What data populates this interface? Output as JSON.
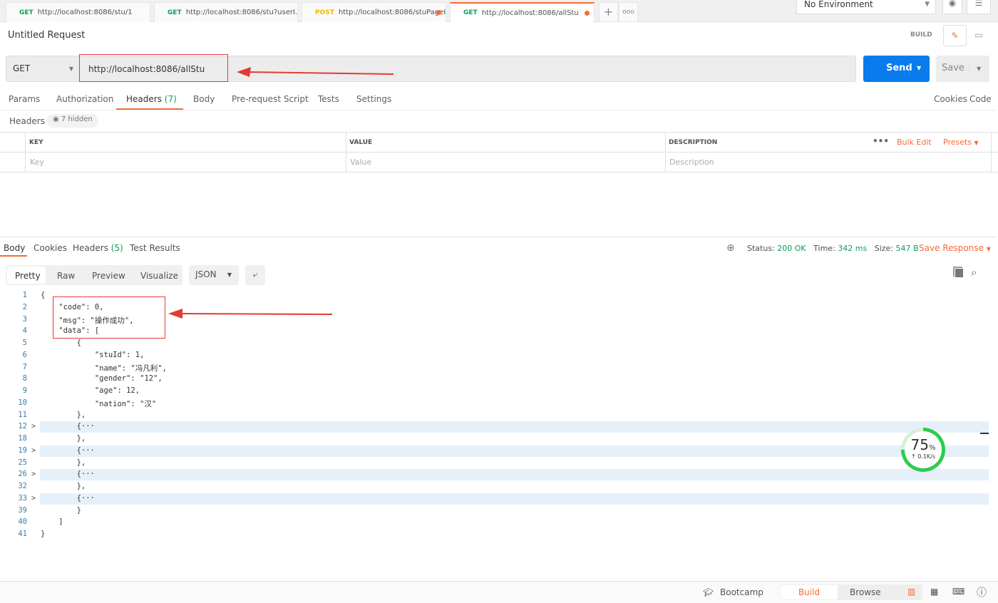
{
  "tabs": [
    {
      "method": "GET",
      "url": "http://localhost:8086/stu/1"
    },
    {
      "method": "GET",
      "url": "http://localhost:8086/stu?userI..."
    },
    {
      "method": "POST",
      "url": "http://localhost:8086/stuPageI...",
      "unsaved": true
    },
    {
      "method": "GET",
      "url": "http://localhost:8086/allStu",
      "unsaved": true,
      "active": true
    }
  ],
  "environment": "No Environment",
  "request": {
    "title": "Untitled Request",
    "build_label": "BUILD",
    "method": "GET",
    "url": "http://localhost:8086/allStu",
    "send": "Send",
    "save": "Save"
  },
  "req_tabs": [
    "Params",
    "Authorization",
    "Headers",
    "(7)",
    "Body",
    "Pre-request Script",
    "Tests",
    "Settings"
  ],
  "cookies": "Cookies",
  "code_link": "Code",
  "headers": {
    "label": "Headers",
    "hidden": "7 hidden",
    "cols": [
      "KEY",
      "VALUE",
      "DESCRIPTION"
    ],
    "bulk_edit": "Bulk Edit",
    "presets": "Presets",
    "placeholders": [
      "Key",
      "Value",
      "Description"
    ]
  },
  "response": {
    "tabs": [
      "Body",
      "Cookies",
      "Headers",
      "(5)",
      "Test Results"
    ],
    "status_label": "Status:",
    "status": "200 OK",
    "time_label": "Time:",
    "time": "342 ms",
    "size_label": "Size:",
    "size": "547 B",
    "save_response": "Save Response",
    "views": [
      "Pretty",
      "Raw",
      "Preview",
      "Visualize"
    ],
    "format": "JSON"
  },
  "code_lines": [
    {
      "n": "1",
      "t": "{"
    },
    {
      "n": "2",
      "t": "    \"code\": 0,"
    },
    {
      "n": "3",
      "t": "    \"msg\": \"操作成功\","
    },
    {
      "n": "4",
      "t": "    \"data\": ["
    },
    {
      "n": "5",
      "t": "        {"
    },
    {
      "n": "6",
      "t": "            \"stuId\": 1,"
    },
    {
      "n": "7",
      "t": "            \"name\": \"冯凡利\","
    },
    {
      "n": "8",
      "t": "            \"gender\": \"12\","
    },
    {
      "n": "9",
      "t": "            \"age\": 12,"
    },
    {
      "n": "10",
      "t": "            \"nation\": \"汉\""
    },
    {
      "n": "11",
      "t": "        },"
    },
    {
      "n": "12",
      "t": "        {···",
      "fold": true
    },
    {
      "n": "18",
      "t": "        },"
    },
    {
      "n": "19",
      "t": "        {···",
      "fold": true
    },
    {
      "n": "25",
      "t": "        },"
    },
    {
      "n": "26",
      "t": "        {···",
      "fold": true
    },
    {
      "n": "32",
      "t": "        },"
    },
    {
      "n": "33",
      "t": "        {···",
      "fold": true
    },
    {
      "n": "39",
      "t": "        }"
    },
    {
      "n": "40",
      "t": "    ]"
    },
    {
      "n": "41",
      "t": "}"
    }
  ],
  "speed": {
    "percent": "75",
    "unit": "%",
    "rate": "↑ 0.1K/s",
    "value": 75
  },
  "footer": {
    "bootcamp": "Bootcamp",
    "build": "Build",
    "browse": "Browse"
  },
  "colors": {
    "accent": "#f26b3a",
    "send": "#097bed",
    "success": "#0f9d58"
  }
}
